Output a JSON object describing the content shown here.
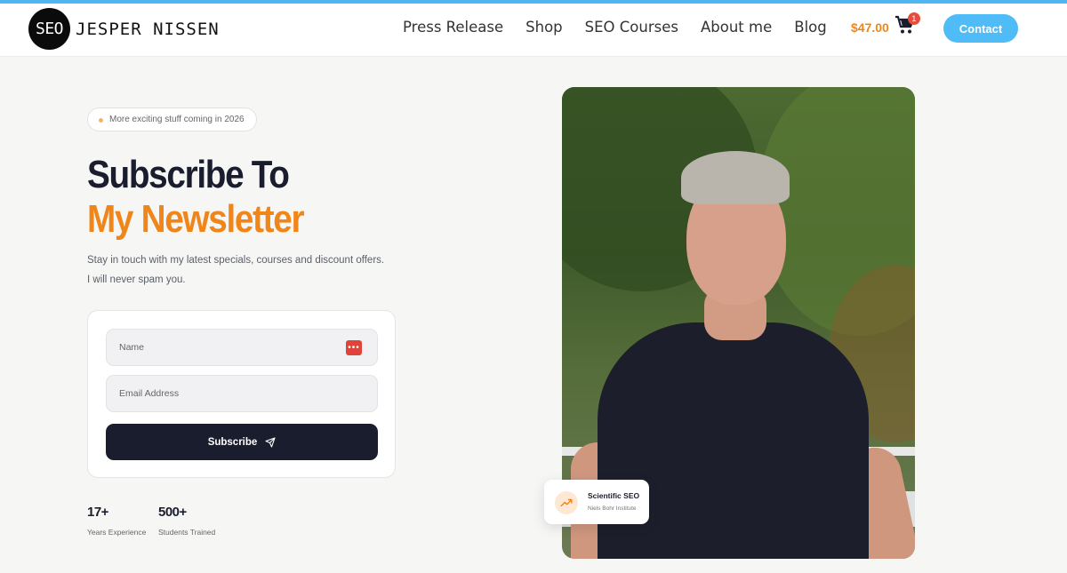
{
  "header": {
    "logo_badge": "SEO",
    "logo_name": "JESPER NISSEN",
    "nav": [
      "Press Release",
      "Shop",
      "SEO Courses",
      "About me",
      "Blog"
    ],
    "cart_price": "$47.00",
    "cart_count": "1",
    "contact_label": "Contact"
  },
  "hero": {
    "pill": "More exciting stuff coming in 2026",
    "title_line1": "Subscribe To",
    "title_line2": "My Newsletter",
    "text": "Stay in touch with my latest specials, courses and discount offers. I will never spam you."
  },
  "form": {
    "name_placeholder": "Name",
    "email_placeholder": "Email Address",
    "subscribe_label": "Subscribe"
  },
  "stats": [
    {
      "value": "17+",
      "label": "Years Experience"
    },
    {
      "value": "500+",
      "label": "Students Trained"
    }
  ],
  "badge": {
    "title": "Scientific SEO",
    "subtitle": "Niels Bohr Institute"
  },
  "colors": {
    "accent_orange": "#f0861a",
    "accent_blue": "#4fbcf7",
    "dark": "#1a1d2e"
  },
  "icons": {
    "cart": "cart-icon",
    "send": "send-icon",
    "trend": "trend-up-icon",
    "password_manager": "password-manager-icon"
  }
}
